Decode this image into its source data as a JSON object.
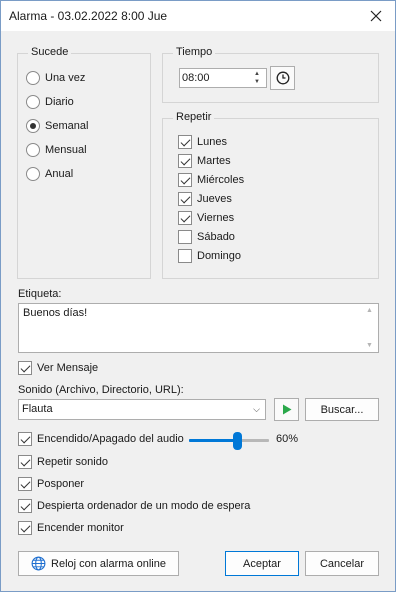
{
  "window": {
    "title": "Alarma - 03.02.2022 8:00 Jue"
  },
  "occurs": {
    "label": "Sucede",
    "options": [
      {
        "label": "Una vez",
        "checked": false
      },
      {
        "label": "Diario",
        "checked": false
      },
      {
        "label": "Semanal",
        "checked": true
      },
      {
        "label": "Mensual",
        "checked": false
      },
      {
        "label": "Anual",
        "checked": false
      }
    ]
  },
  "time": {
    "label": "Tiempo",
    "value": "08:00"
  },
  "repeat": {
    "label": "Repetir",
    "days": [
      {
        "label": "Lunes",
        "checked": true
      },
      {
        "label": "Martes",
        "checked": true
      },
      {
        "label": "Miércoles",
        "checked": true
      },
      {
        "label": "Jueves",
        "checked": true
      },
      {
        "label": "Viernes",
        "checked": true
      },
      {
        "label": "Sábado",
        "checked": false
      },
      {
        "label": "Domingo",
        "checked": false
      }
    ]
  },
  "tag": {
    "label": "Etiqueta:",
    "value": "Buenos días!"
  },
  "show_message": {
    "label": "Ver Mensaje",
    "checked": true
  },
  "sound": {
    "label": "Sonido (Archivo, Directorio, URL):",
    "value": "Flauta",
    "browse_label": "Buscar..."
  },
  "options": [
    {
      "label": "Encendido/Apagado del audio",
      "checked": true
    },
    {
      "label": "Repetir sonido",
      "checked": true
    },
    {
      "label": "Posponer",
      "checked": true
    },
    {
      "label": "Despierta ordenador de un modo de espera",
      "checked": true
    },
    {
      "label": "Encender monitor",
      "checked": true
    }
  ],
  "volume": {
    "value": 0.6,
    "text": "60%"
  },
  "buttons": {
    "online": "Reloj con alarma online",
    "accept": "Aceptar",
    "cancel": "Cancelar"
  },
  "colors": {
    "accent": "#0078d7",
    "play": "#2aa84a",
    "globe": "#1e6fd0"
  }
}
